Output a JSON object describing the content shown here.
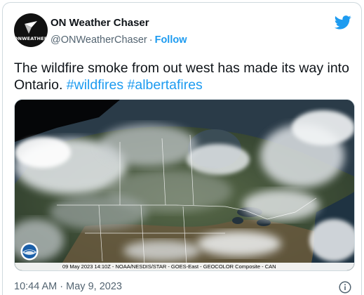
{
  "author": {
    "display_name": "ON Weather Chaser",
    "handle": "@ONWeatherChaser",
    "separator": "·",
    "follow_label": "Follow",
    "avatar_text": "ONWEATHER"
  },
  "tweet": {
    "text": "The wildfire smoke from out west has made its way into Ontario.",
    "hashtags": [
      "#wildfires",
      "#albertafires"
    ]
  },
  "media": {
    "caption": "09 May 2023 14:10Z - NOAA/NESDIS/STAR - GOES-East - GEOCOLOR Composite - CAN"
  },
  "footer": {
    "timestamp": "10:44 AM · May 9, 2023"
  },
  "colors": {
    "accent": "#1d9bf0",
    "secondary_text": "#536471",
    "border": "#cfd9de"
  },
  "icons": {
    "brand": "twitter-bird-icon",
    "info": "info-icon",
    "agency_logo": "noaa-logo"
  }
}
